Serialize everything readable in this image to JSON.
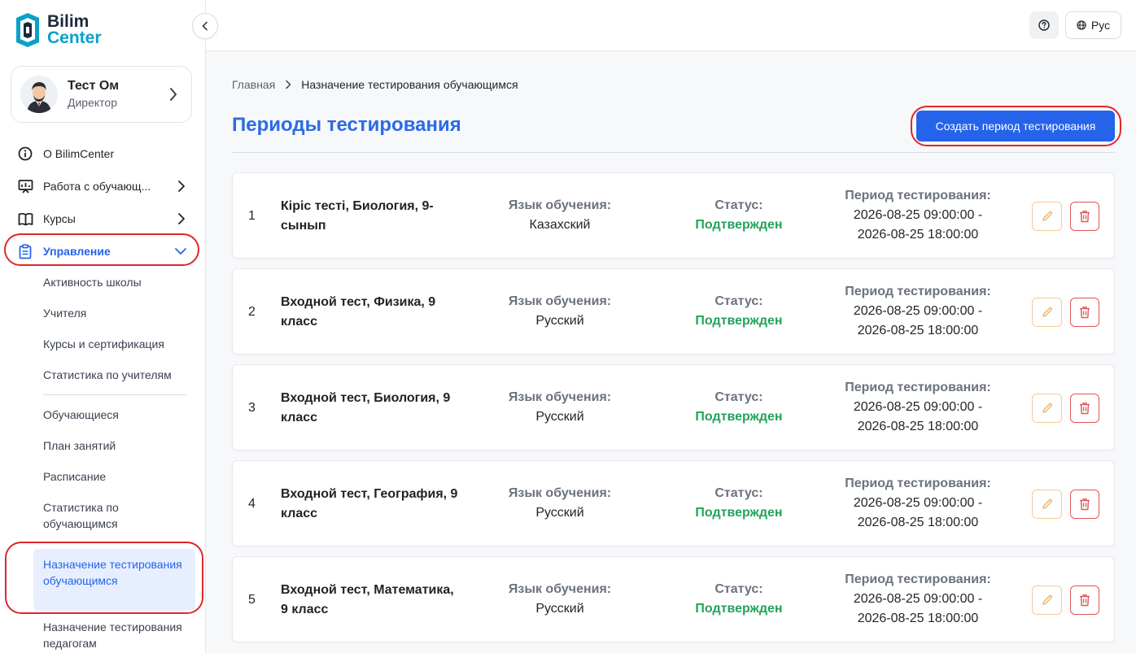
{
  "brand": {
    "line1": "Bilim",
    "line2": "Center"
  },
  "profile": {
    "name": "Тест Ом",
    "role": "Директор"
  },
  "nav": {
    "items": [
      {
        "label": "О BilimCenter",
        "icon": "info-icon"
      },
      {
        "label": "Работа с обучающ...",
        "icon": "presentation-icon"
      },
      {
        "label": "Курсы",
        "icon": "book-icon"
      },
      {
        "label": "Управление",
        "icon": "clipboard-icon"
      }
    ],
    "sub_items": [
      "Активность школы",
      "Учителя",
      "Курсы и сертификация",
      "Статистика по учителям",
      "Обучающиеся",
      "План занятий",
      "Расписание",
      "Статистика по обучающимся",
      "Назначение тестирования обучающимся",
      "Назначение тестирования педагогам"
    ]
  },
  "topbar": {
    "lang_label": "Рус",
    "help_icon": "question-circle-icon",
    "globe_icon": "globe-icon"
  },
  "breadcrumb": {
    "home": "Главная",
    "current": "Назначение тестирования обучающимся"
  },
  "page": {
    "title": "Периоды тестирования",
    "create_button": "Создать период тестирования"
  },
  "labels": {
    "language": "Язык обучения:",
    "status": "Статус:",
    "period": "Период тестирования:"
  },
  "periods": [
    {
      "num": "1",
      "name": "Кіріс тесті, Биология, 9-сынып",
      "language": "Казахский",
      "status": "Подтвержден",
      "start": "2026-08-25 09:00:00 -",
      "end": "2026-08-25 18:00:00"
    },
    {
      "num": "2",
      "name": "Входной тест, Физика, 9 класс",
      "language": "Русский",
      "status": "Подтвержден",
      "start": "2026-08-25 09:00:00 -",
      "end": "2026-08-25 18:00:00"
    },
    {
      "num": "3",
      "name": "Входной тест, Биология, 9 класс",
      "language": "Русский",
      "status": "Подтвержден",
      "start": "2026-08-25 09:00:00 -",
      "end": "2026-08-25 18:00:00"
    },
    {
      "num": "4",
      "name": "Входной тест, География, 9 класс",
      "language": "Русский",
      "status": "Подтвержден",
      "start": "2026-08-25 09:00:00 -",
      "end": "2026-08-25 18:00:00"
    },
    {
      "num": "5",
      "name": "Входной тест, Математика, 9 класс",
      "language": "Русский",
      "status": "Подтвержден",
      "start": "2026-08-25 09:00:00 -",
      "end": "2026-08-25 18:00:00"
    }
  ],
  "colors": {
    "accent": "#2563eb",
    "title": "#2b6be4",
    "success": "#22a35a",
    "danger": "#e25555",
    "warning": "#f5a55a",
    "annotation": "#e0262b"
  }
}
